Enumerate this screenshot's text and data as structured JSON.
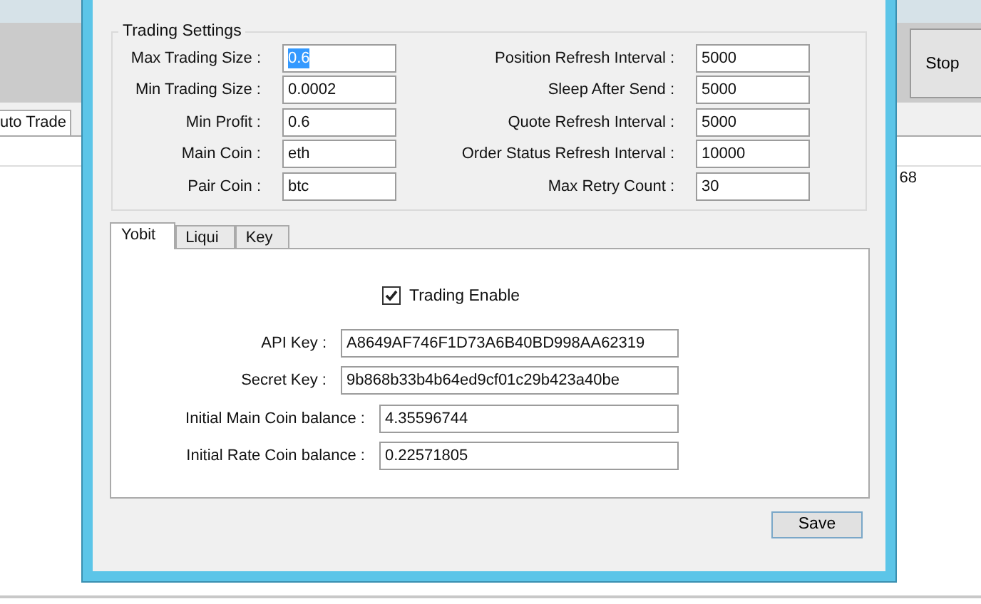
{
  "app": {
    "tab": "uto Trade",
    "stop_button": "Stop",
    "cells": [
      "68"
    ]
  },
  "dialog": {
    "group_title": "Trading Settings",
    "left_fields": [
      {
        "label": "Max Trading Size :",
        "value": "0.6",
        "text_selected": true
      },
      {
        "label": "Min Trading Size :",
        "value": "0.0002",
        "text_selected": false
      },
      {
        "label": "Min Profit :",
        "value": "0.6",
        "text_selected": false
      },
      {
        "label": "Main Coin :",
        "value": "eth",
        "text_selected": false
      },
      {
        "label": "Pair Coin :",
        "value": "btc",
        "text_selected": false
      }
    ],
    "right_fields": [
      {
        "label": "Position Refresh Interval :",
        "value": "5000",
        "text_selected": false
      },
      {
        "label": "Sleep After Send :",
        "value": "5000",
        "text_selected": false
      },
      {
        "label": "Quote Refresh Interval :",
        "value": "5000",
        "text_selected": false
      },
      {
        "label": "Order Status Refresh Interval :",
        "value": "10000",
        "text_selected": false
      },
      {
        "label": "Max Retry Count :",
        "value": "30",
        "text_selected": false
      }
    ],
    "tabs": [
      {
        "label": "Yobit",
        "selected": true
      },
      {
        "label": "Liqui",
        "selected": false
      },
      {
        "label": "Key",
        "selected": false
      }
    ],
    "trading_enable": {
      "label": "Trading Enable",
      "checked": true
    },
    "key_fields": [
      {
        "kind": "key",
        "label": "API Key :",
        "value": "A8649AF746F1D73A6B40BD998AA62319"
      },
      {
        "kind": "key",
        "label": "Secret Key :",
        "value": "9b868b33b4b64ed9cf01c29b423a40be"
      },
      {
        "kind": "balance",
        "label": "Initial Main Coin balance :",
        "value": "4.35596744"
      },
      {
        "kind": "balance",
        "label": "Initial Rate Coin balance :",
        "value": "0.22571805"
      }
    ],
    "save_button": "Save"
  }
}
